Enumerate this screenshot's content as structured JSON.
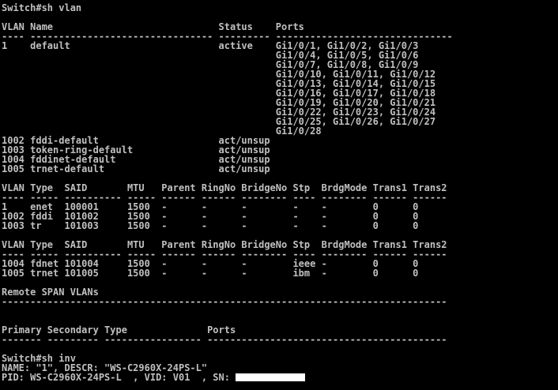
{
  "terminal": {
    "lines": [
      "Switch#sh vlan",
      "",
      "VLAN Name                             Status    Ports",
      "---- -------------------------------- --------- -------------------------------",
      "1    default                          active    Gi1/0/1, Gi1/0/2, Gi1/0/3",
      "                                                Gi1/0/4, Gi1/0/5, Gi1/0/6",
      "                                                Gi1/0/7, Gi1/0/8, Gi1/0/9",
      "                                                Gi1/0/10, Gi1/0/11, Gi1/0/12",
      "                                                Gi1/0/13, Gi1/0/14, Gi1/0/15",
      "                                                Gi1/0/16, Gi1/0/17, Gi1/0/18",
      "                                                Gi1/0/19, Gi1/0/20, Gi1/0/21",
      "                                                Gi1/0/22, Gi1/0/23, Gi1/0/24",
      "                                                Gi1/0/25, Gi1/0/26, Gi1/0/27",
      "                                                Gi1/0/28",
      "1002 fddi-default                     act/unsup",
      "1003 token-ring-default               act/unsup",
      "1004 fddinet-default                  act/unsup",
      "1005 trnet-default                    act/unsup",
      "",
      "VLAN Type  SAID       MTU   Parent RingNo BridgeNo Stp  BrdgMode Trans1 Trans2",
      "---- ----- ---------- ----- ------ ------ -------- ---- -------- ------ ------",
      "1    enet  100001     1500  -      -      -        -    -        0      0",
      "1002 fddi  101002     1500  -      -      -        -    -        0      0",
      "1003 tr    101003     1500  -      -      -        -    -        0      0",
      "",
      "VLAN Type  SAID       MTU   Parent RingNo BridgeNo Stp  BrdgMode Trans1 Trans2",
      "---- ----- ---------- ----- ------ ------ -------- ---- -------- ------ ------",
      "1004 fdnet 101004     1500  -      -      -        ieee -        0      0",
      "1005 trnet 101005     1500  -      -      -        ibm  -        0      0",
      "",
      "Remote SPAN VLANs",
      "------------------------------------------------------------------------------",
      "",
      "",
      "Primary Secondary Type              Ports",
      "------- --------- ----------------- ------------------------------------------",
      "",
      "Switch#sh inv",
      "NAME: \"1\", DESCR: \"WS-C2960X-24PS-L\"",
      "PID: WS-C2960X-24PS-L  , VID: V01  , SN: "
    ],
    "colors": {
      "background": "#000000",
      "text": "#c0c0c0",
      "redaction": "#ffffff"
    }
  }
}
